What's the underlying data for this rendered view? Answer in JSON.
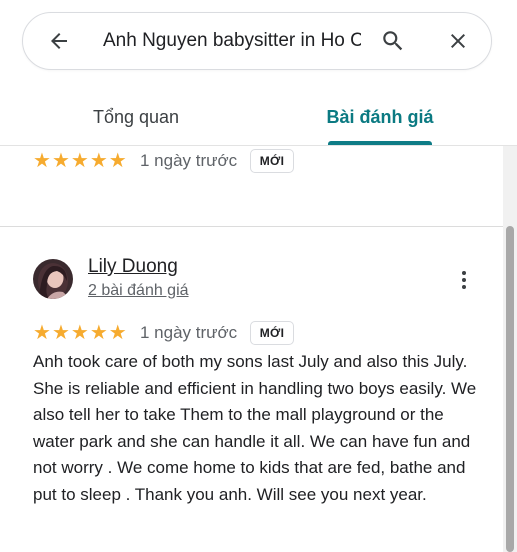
{
  "search": {
    "query": "Anh Nguyen babysitter in Ho Chi Minh City",
    "back_icon": "arrow-back-icon",
    "search_icon": "search-icon",
    "close_icon": "close-icon"
  },
  "tabs": [
    {
      "label": "Tổng quan",
      "active": false
    },
    {
      "label": "Bài đánh giá",
      "active": true
    }
  ],
  "colors": {
    "accent": "#0e7c86",
    "star": "#f6ab2f"
  },
  "reviews": [
    {
      "rating": 5,
      "time": "1 ngày trước",
      "badge": "MỚI"
    },
    {
      "reviewer_name": "Lily Duong",
      "reviewer_count": "2 bài đánh giá",
      "rating": 5,
      "time": "1 ngày trước",
      "badge": "MỚI",
      "text": "Anh took care of both my sons last July and also this July. She is reliable and efficient in handling two boys easily. We also tell her to take Them to the mall playground or the water park and she can handle it all. We can have fun and not worry . We come home to kids that are fed, bathe and put to sleep . Thank you anh. Will see you next year."
    }
  ]
}
